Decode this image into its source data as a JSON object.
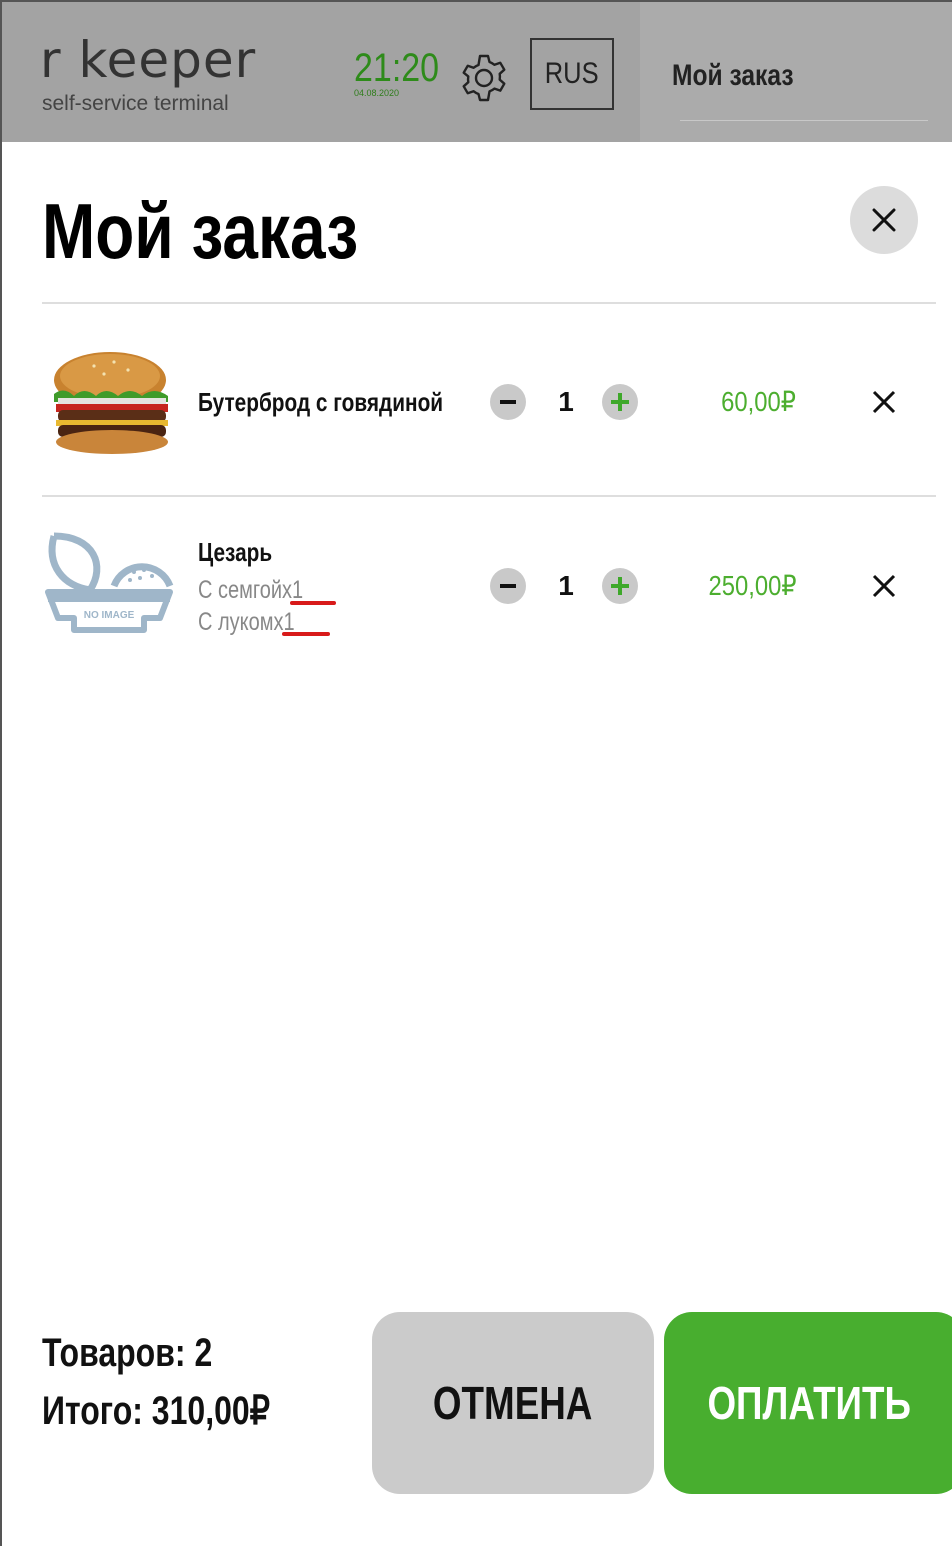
{
  "header": {
    "logo": "r  keeper",
    "logo_sub": "self-service terminal",
    "time": "21:20",
    "date": "04.08.2020",
    "language": "RUS",
    "panel_title": "Мой заказ"
  },
  "order": {
    "title": "Мой заказ",
    "items": [
      {
        "name": "Бутерброд с говядиной",
        "quantity": "1",
        "price": "60,00₽",
        "image": "burger-image",
        "modifiers": []
      },
      {
        "name": "Цезарь",
        "quantity": "1",
        "price": "250,00₽",
        "image": "no-image-placeholder",
        "no_image_text": "NO IMAGE",
        "modifiers": [
          {
            "text": "С семгой",
            "count": "x1"
          },
          {
            "text": "С луком",
            "count": "x1"
          }
        ]
      }
    ]
  },
  "footer": {
    "items_count": "Товаров: 2",
    "total": "Итого: 310,00₽",
    "cancel_label": "ОТМЕНА",
    "pay_label": "ОПЛАТИТЬ"
  },
  "colors": {
    "accent_green": "#48ae2f",
    "price_green": "#4cae2f",
    "header_gray": "#a6a6a6",
    "annotation_red": "#d81a1a"
  }
}
